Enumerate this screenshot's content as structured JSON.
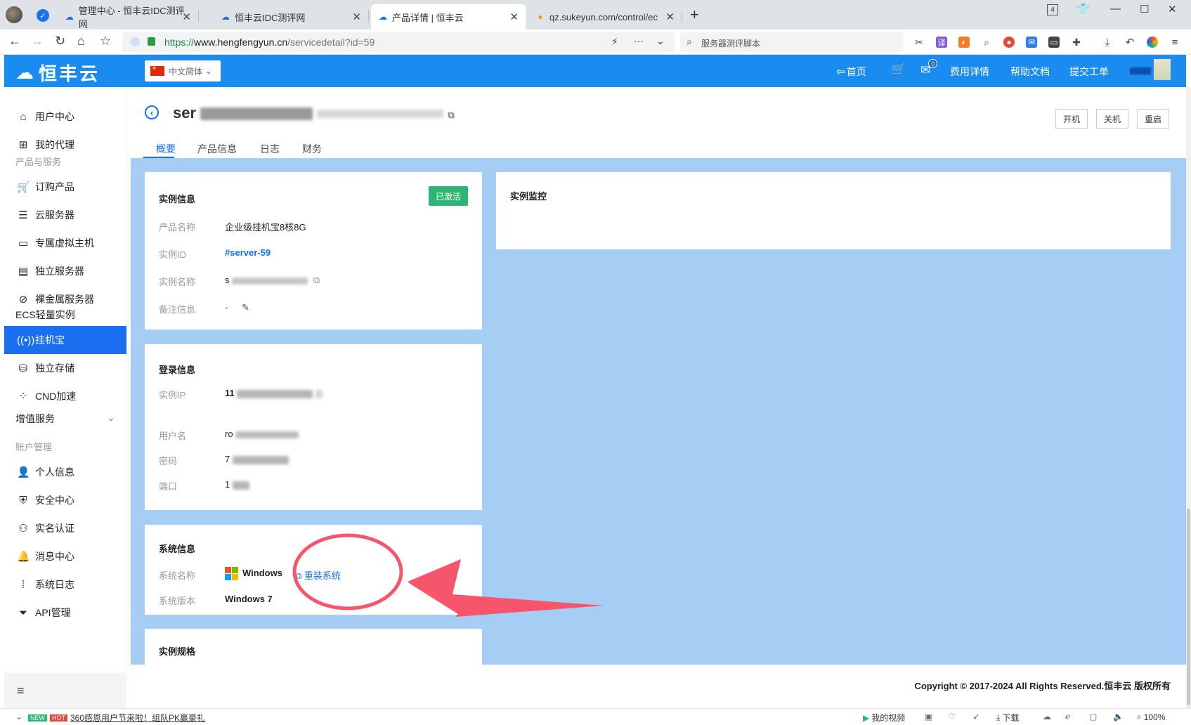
{
  "browser": {
    "tabs": [
      {
        "title": "管理中心 - 恒丰云IDC测评网",
        "icon": "cloud-icon"
      },
      {
        "title": "恒丰云IDC测评网",
        "icon": "cloud-icon"
      },
      {
        "title": "产品详情 | 恒丰云",
        "icon": "cloud-icon"
      },
      {
        "title": "qz.sukeyun.com/control/ec",
        "icon": "chrome-icon"
      }
    ],
    "tab_counter": "4",
    "url_scheme": "https://",
    "url_host": "www.hengfengyun.cn",
    "url_path": "/servicedetail?id=59",
    "search_placeholder": "服务器测评脚本"
  },
  "header": {
    "logo_text": "恒丰云",
    "language": "中文简体",
    "nav": {
      "home": "首页",
      "message_count": "0",
      "billing": "费用详情",
      "help": "帮助文档",
      "ticket": "提交工单"
    }
  },
  "sidebar": {
    "user_center": "用户中心",
    "my_agent": "我的代理",
    "group_products": "产品与服务",
    "order_products": "订购产品",
    "cloud_server": "云服务器",
    "dedicated_vm": "专属虚拟主机",
    "dedicated_server": "独立服务器",
    "bare_metal": "裸金属服务器",
    "ecs_light": "ECS轻量实例",
    "guajibao": "挂机宝",
    "storage": "独立存储",
    "cdn": "CND加速",
    "value_added": "增值服务",
    "group_account": "账户管理",
    "profile": "个人信息",
    "security": "安全中心",
    "realname": "实名认证",
    "messages": "消息中心",
    "syslog": "系统日志",
    "api": "API管理"
  },
  "page": {
    "title_visible": "ser",
    "buttons": {
      "power_on": "开机",
      "power_off": "关机",
      "restart": "重启"
    },
    "tabs": [
      "概要",
      "产品信息",
      "日志",
      "财务"
    ]
  },
  "instance_info": {
    "title": "实例信息",
    "status": "已激活",
    "labels": {
      "product_name": "产品名称",
      "instance_id": "实例ID",
      "instance_name": "实例名称",
      "remark": "备注信息"
    },
    "product_name": "企业级挂机宝8核8G",
    "instance_id": "#server-59",
    "instance_name_visible": "s",
    "remark": "-"
  },
  "login_info": {
    "title": "登录信息",
    "labels": {
      "ip": "实例IP",
      "username": "用户名",
      "password": "密码",
      "port": "端口"
    },
    "ip_visible": "11",
    "username_visible": "ro",
    "password_visible": "7",
    "port_visible": "1"
  },
  "system_info": {
    "title": "系统信息",
    "labels": {
      "os_name": "系统名称",
      "os_version": "系统版本"
    },
    "os_name": "Windows",
    "reinstall": "重装系统",
    "os_version": "Windows 7"
  },
  "spec_info": {
    "title": "实例规格"
  },
  "monitor": {
    "title": "实例监控"
  },
  "footer": {
    "copyright": "Copyright © 2017-2024 All Rights Reserved.恒丰云 版权所有"
  },
  "statusbar": {
    "new": "NEW",
    "hot": "HOT",
    "promo": "360感恩用户节来啦！组队PK赢豪礼",
    "my_video": "我的视频",
    "download": "下载",
    "zoom": "100%"
  },
  "colors": {
    "brand_blue": "#1a8cf0",
    "active_blue": "#1a6ff0",
    "content_bg": "#a6cdf3",
    "status_green": "#2bb673",
    "annotation_red": "#f5566b"
  }
}
